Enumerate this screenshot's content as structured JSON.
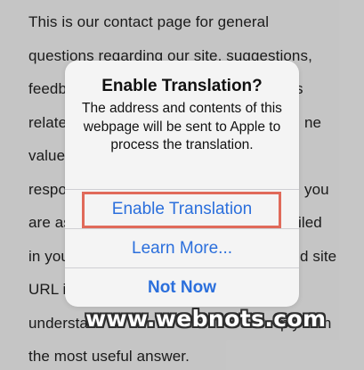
{
  "background_page": {
    "lines": [
      "This is our contact page for general",
      "questions regarding our site, suggestions,",
      "feedback",
      "related",
      "value",
      "respo",
      "are as",
      "in you",
      "URL i",
      "understa",
      "the most useful answer."
    ],
    "fragments": {
      "line3_right": "s",
      "line4_right": "ne",
      "line6_right": "you",
      "line7_right": "iled",
      "line8_right": "d site",
      "line10_right": "ply with"
    }
  },
  "alert": {
    "title": "Enable Translation?",
    "message": "The address and contents of this webpage will be sent to Apple to process the translation.",
    "actions": {
      "enable": "Enable Translation",
      "learn_more": "Learn More...",
      "not_now": "Not Now"
    },
    "accent_color": "#2b6fdc"
  },
  "annotation": {
    "highlight_color": "#e06a5a"
  },
  "watermark": "www.webnots.com"
}
